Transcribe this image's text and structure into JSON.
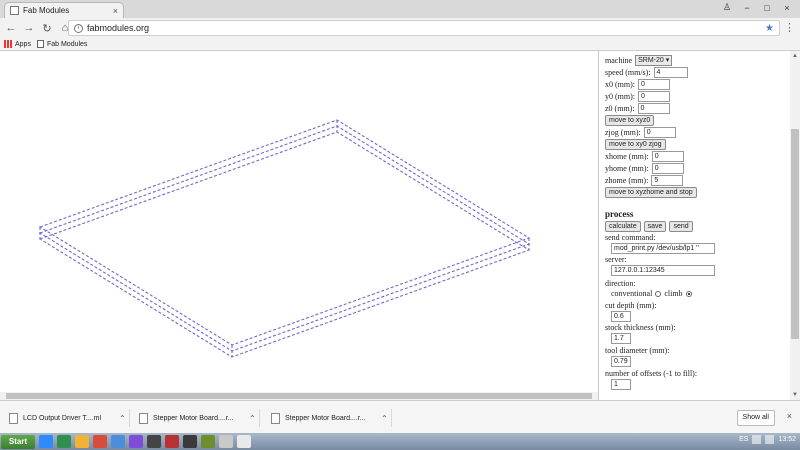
{
  "browser": {
    "tab_title": "Fab Modules",
    "tab_close": "×",
    "url": "fabmodules.org",
    "bookmarks": [
      "Apps",
      "Fab Modules"
    ]
  },
  "panel": {
    "machine_label": "machine",
    "machine_value": "SRM-20",
    "speed_label": "speed (mm/s):",
    "speed_value": "4",
    "x0_label": "x0 (mm):",
    "x0_value": "0",
    "y0_label": "y0 (mm):",
    "y0_value": "0",
    "z0_label": "z0 (mm):",
    "z0_value": "0",
    "move_xyz0": "move to xyz0",
    "zjog_label": "zjog (mm):",
    "zjog_value": "0",
    "move_xy0_zjog": "move to xy0 zjog",
    "xhome_label": "xhome (mm):",
    "xhome_value": "0",
    "yhome_label": "yhome (mm):",
    "yhome_value": "0",
    "zhome_label": "zhome (mm):",
    "zhome_value": "5",
    "move_home_stop": "move to xyzhome and stop",
    "process_heading": "process",
    "calculate": "calculate",
    "save": "save",
    "send": "send",
    "send_command_label": "send command:",
    "send_command_value": "mod_print.py /dev/usb/lp1 ''",
    "server_label": "server:",
    "server_value": "127.0.0.1:12345",
    "direction_label": "direction:",
    "conventional": "conventional",
    "climb": "climb",
    "selected_direction": "climb",
    "cut_depth_label": "cut depth (mm):",
    "cut_depth_value": "0.6",
    "stock_thickness_label": "stock thickness (mm):",
    "stock_thickness_value": "1.7",
    "tool_diameter_label": "tool diameter (mm):",
    "tool_diameter_value": "0.79",
    "offsets_label": "number of offsets (-1 to fill):",
    "offsets_value": "1"
  },
  "downloads": {
    "items": [
      "LCD Output Driver T....ml",
      "Stepper Motor Board....r...",
      "Stepper Motor Board....r..."
    ],
    "show_all": "Show all"
  },
  "taskbar": {
    "start": "Start",
    "language": "ES",
    "time": "13:52"
  },
  "colors": {
    "toolpath": "#6b6bcf",
    "accent": "#4a7bd0"
  }
}
